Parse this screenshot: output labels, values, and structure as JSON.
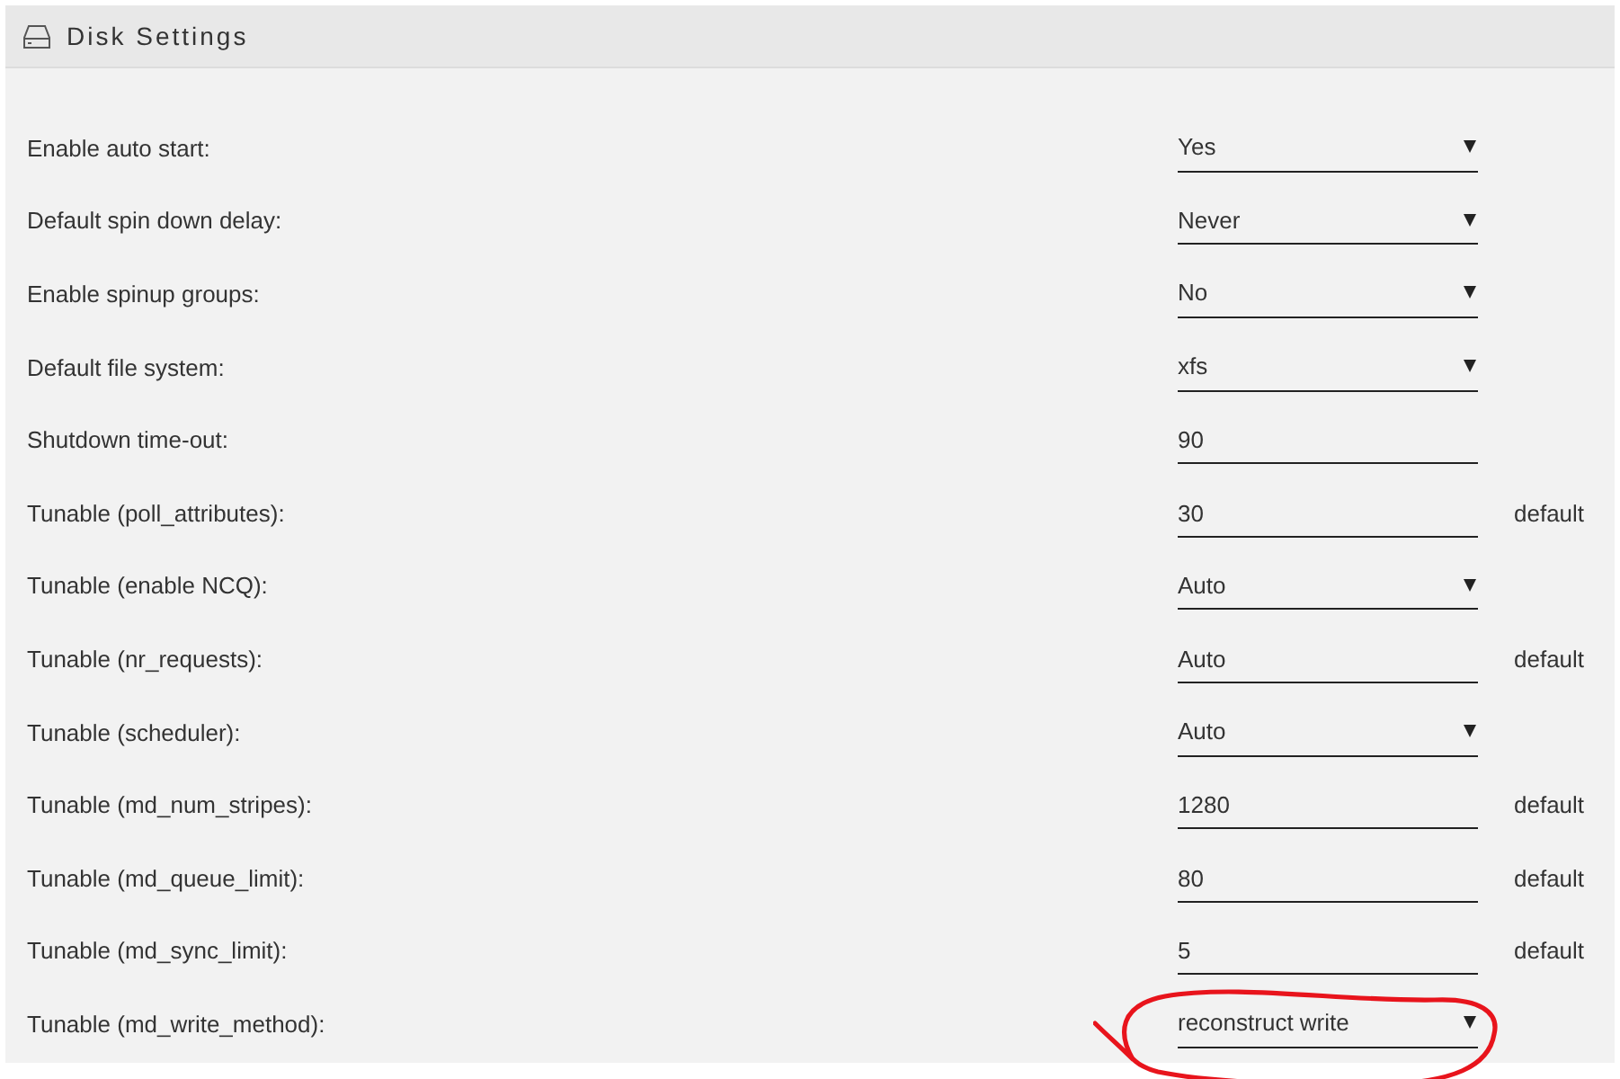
{
  "header": {
    "title": "Disk Settings"
  },
  "rows": [
    {
      "label": "Enable auto start:",
      "kind": "select",
      "value": "Yes",
      "circled": false
    },
    {
      "label": "Default spin down delay:",
      "kind": "select",
      "value": "Never",
      "circled": false
    },
    {
      "label": "Enable spinup groups:",
      "kind": "select",
      "value": "No",
      "circled": false
    },
    {
      "label": "Default file system:",
      "kind": "select",
      "value": "xfs",
      "circled": false
    },
    {
      "label": "Shutdown time-out:",
      "kind": "text",
      "value": "90",
      "circled": false
    },
    {
      "label": "Tunable (poll_attributes):",
      "kind": "text",
      "value": "30",
      "note": "default",
      "circled": false
    },
    {
      "label": "Tunable (enable NCQ):",
      "kind": "select",
      "value": "Auto",
      "circled": false
    },
    {
      "label": "Tunable (nr_requests):",
      "kind": "text",
      "value": "Auto",
      "note": "default",
      "circled": false
    },
    {
      "label": "Tunable (scheduler):",
      "kind": "select",
      "value": "Auto",
      "circled": false
    },
    {
      "label": "Tunable (md_num_stripes):",
      "kind": "text",
      "value": "1280",
      "note": "default",
      "circled": false
    },
    {
      "label": "Tunable (md_queue_limit):",
      "kind": "text",
      "value": "80",
      "note": "default",
      "circled": false
    },
    {
      "label": "Tunable (md_sync_limit):",
      "kind": "text",
      "value": "5",
      "note": "default",
      "circled": false
    },
    {
      "label": "Tunable (md_write_method):",
      "kind": "select",
      "value": "reconstruct write",
      "circled": true
    }
  ]
}
